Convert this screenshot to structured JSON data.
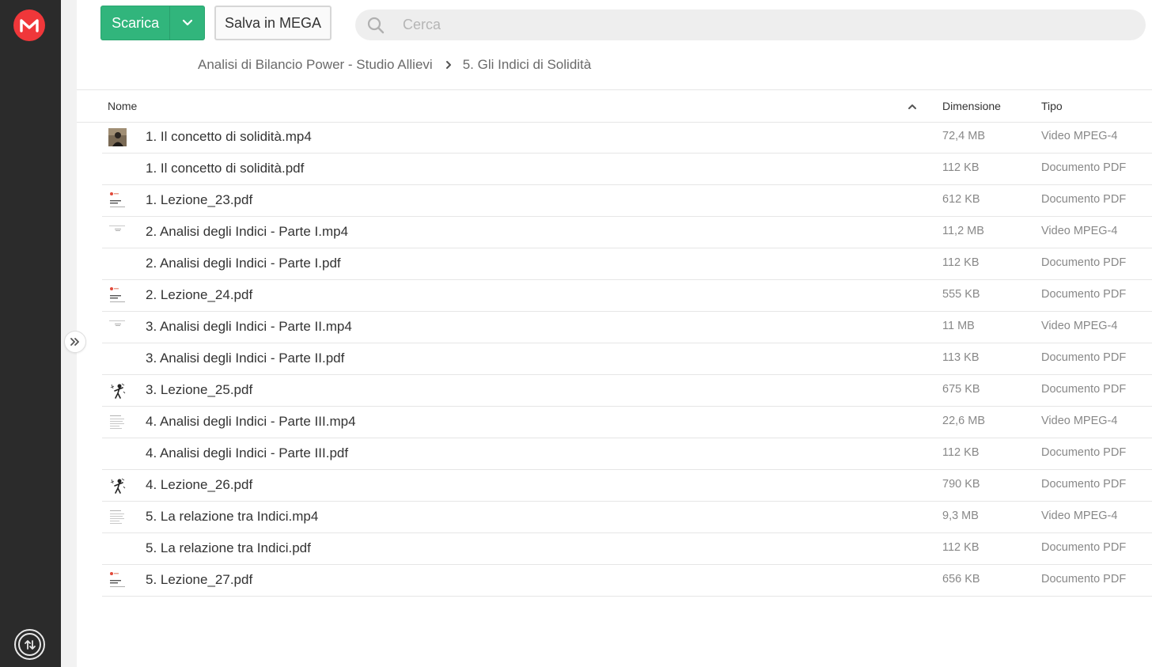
{
  "app": {
    "brand_color": "#f0373a",
    "accent_color": "#31b57c"
  },
  "toolbar": {
    "download_label": "Scarica",
    "save_label": "Salva in MEGA"
  },
  "search": {
    "placeholder": "Cerca",
    "value": ""
  },
  "breadcrumb": {
    "items": [
      "Analisi di Bilancio Power - Studio Allievi",
      "5. Gli Indici di Solidità"
    ]
  },
  "table": {
    "columns": {
      "name": "Nome",
      "size": "Dimensione",
      "type": "Tipo"
    },
    "sort": "name-ascending",
    "rows": [
      {
        "name": "1. Il concetto di solidità.mp4",
        "size": "72,4 MB",
        "type": "Video MPEG-4",
        "thumb": "person-photo"
      },
      {
        "name": "1. Il concetto di solidità.pdf",
        "size": "112 KB",
        "type": "Documento PDF",
        "thumb": "none"
      },
      {
        "name": "1. Lezione_23.pdf",
        "size": "612 KB",
        "type": "Documento PDF",
        "thumb": "slide-red-logo"
      },
      {
        "name": "2. Analisi degli Indici - Parte I.mp4",
        "size": "11,2 MB",
        "type": "Video MPEG-4",
        "thumb": "slide-lines"
      },
      {
        "name": "2. Analisi degli Indici - Parte I.pdf",
        "size": "112 KB",
        "type": "Documento PDF",
        "thumb": "none"
      },
      {
        "name": "2. Lezione_24.pdf",
        "size": "555 KB",
        "type": "Documento PDF",
        "thumb": "slide-red-logo"
      },
      {
        "name": "3. Analisi degli Indici - Parte II.mp4",
        "size": "11 MB",
        "type": "Video MPEG-4",
        "thumb": "slide-lines"
      },
      {
        "name": "3. Analisi degli Indici - Parte II.pdf",
        "size": "113 KB",
        "type": "Documento PDF",
        "thumb": "none"
      },
      {
        "name": "3. Lezione_25.pdf",
        "size": "675 KB",
        "type": "Documento PDF",
        "thumb": "figure-sketch"
      },
      {
        "name": "4. Analisi degli Indici - Parte III.mp4",
        "size": "22,6 MB",
        "type": "Video MPEG-4",
        "thumb": "slide-text"
      },
      {
        "name": "4. Analisi degli Indici - Parte III.pdf",
        "size": "112 KB",
        "type": "Documento PDF",
        "thumb": "none"
      },
      {
        "name": "4. Lezione_26.pdf",
        "size": "790 KB",
        "type": "Documento PDF",
        "thumb": "figure-sketch"
      },
      {
        "name": "5. La relazione tra Indici.mp4",
        "size": "9,3 MB",
        "type": "Video MPEG-4",
        "thumb": "slide-text"
      },
      {
        "name": "5. La relazione tra Indici.pdf",
        "size": "112 KB",
        "type": "Documento PDF",
        "thumb": "none"
      },
      {
        "name": "5. Lezione_27.pdf",
        "size": "656 KB",
        "type": "Documento PDF",
        "thumb": "slide-red-logo"
      }
    ]
  }
}
